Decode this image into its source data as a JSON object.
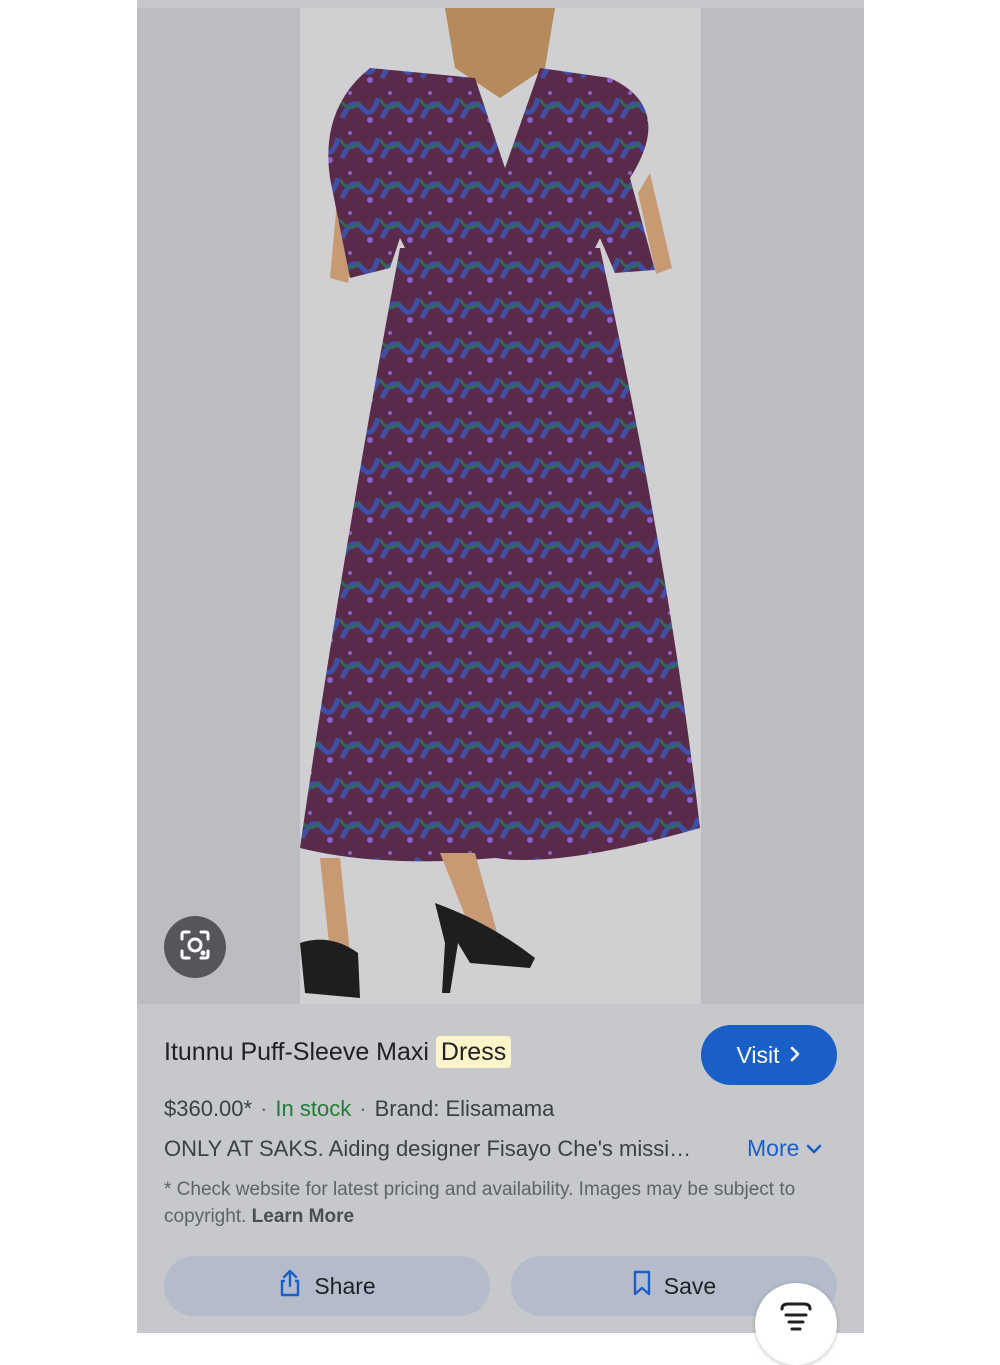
{
  "product": {
    "title_prefix": "Itunnu Puff-Sleeve Maxi",
    "title_highlight": "Dress",
    "price": "$360.00*",
    "separator": "·",
    "stock": "In stock",
    "brand": "Brand: Elisamama",
    "description": "ONLY AT SAKS. Aiding designer Fisayo Che's missi…",
    "more_label": "More",
    "disclaimer": "* Check website for latest pricing and availability. Images may be subject to copyright.",
    "learn_more": "Learn More"
  },
  "actions": {
    "visit_label": "Visit",
    "share_label": "Share",
    "save_label": "Save"
  },
  "icons": {
    "lens": "lens-icon",
    "visit": "chevron-right-icon",
    "more": "chevron-down-icon",
    "share": "share-icon",
    "save": "bookmark-icon",
    "fab": "filter-lines-icon"
  },
  "colors": {
    "accent": "#1a5fc7",
    "in_stock": "#1e7e34",
    "highlight": "#fdf5c9"
  }
}
